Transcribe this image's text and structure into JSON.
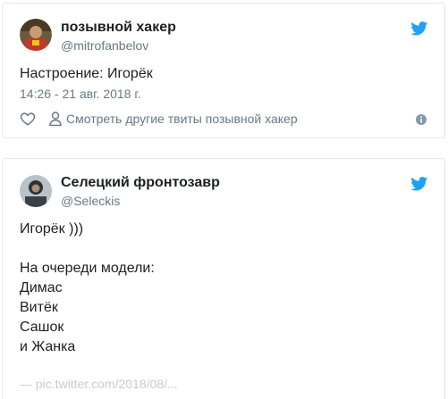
{
  "tweets": [
    {
      "author_name": "позывной хакер",
      "author_handle": "@mitrofanbelov",
      "text": "Настроение: Игорёк",
      "timestamp": "14:26 - 21 авг. 2018 г.",
      "more_tweets_link": "Смотреть другие твиты позывной хакер",
      "icons": [
        "twitter-bird-icon",
        "heart-icon",
        "person-icon",
        "info-icon"
      ]
    },
    {
      "author_name": "Селецкий фронтозавр",
      "author_handle": "@Seleckis",
      "text": "Игорёк )))\n\nНа очереди модели:\nДимас\nВитёк\nСашок\nи Жанка",
      "faded_line": "— pic.twitter.com/2018/08/...",
      "icons": [
        "twitter-bird-icon"
      ]
    }
  ],
  "colors": {
    "brand": "#1da1f2",
    "text": "#1c2022",
    "muted": "#697882",
    "border": "#e1e8ed"
  }
}
